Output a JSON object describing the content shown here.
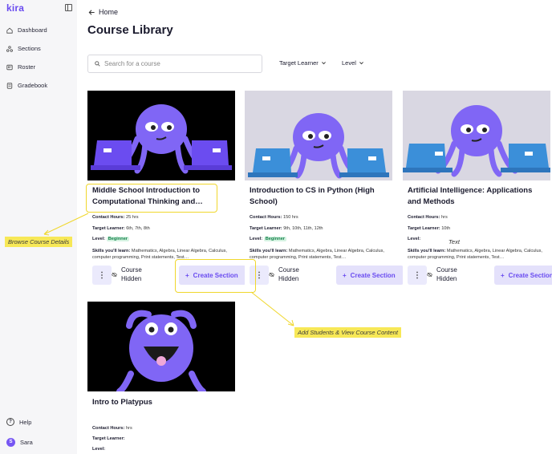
{
  "app": {
    "logo": "kira"
  },
  "sidebar": {
    "items": [
      {
        "label": "Dashboard",
        "icon": "home-icon"
      },
      {
        "label": "Sections",
        "icon": "sections-icon"
      },
      {
        "label": "Roster",
        "icon": "roster-icon"
      },
      {
        "label": "Gradebook",
        "icon": "gradebook-icon"
      }
    ],
    "help_label": "Help",
    "user": {
      "initial": "S",
      "name": "Sara"
    }
  },
  "header": {
    "back_label": "Home",
    "title": "Course Library"
  },
  "search": {
    "placeholder": "Search for a course",
    "value": ""
  },
  "filters": [
    {
      "label": "Target Learner"
    },
    {
      "label": "Level"
    }
  ],
  "courses": [
    {
      "title": "Middle School Introduction to Computational Thinking and…",
      "contact_hours_label": "Contact Hours:",
      "contact_hours": "25 hrs",
      "target_learner_label": "Target Learner:",
      "target_learner": "6th, 7th, 8th",
      "level_label": "Level:",
      "level": "Beginner",
      "skills_label": "Skills you'll learn:",
      "skills": "Mathematics, Algebra, Linear Algebra, Calculus, computer programming, Print statements, Test…",
      "status": "Course Hidden",
      "action": "Create Section",
      "image_bg": "#000000"
    },
    {
      "title": "Introduction to CS in Python (High School)",
      "contact_hours_label": "Contact Hours:",
      "contact_hours": "150 hrs",
      "target_learner_label": "Target Learner:",
      "target_learner": "9th, 10th, 11th, 12th",
      "level_label": "Level:",
      "level": "Beginner",
      "skills_label": "Skills you'll learn:",
      "skills": "Mathematics, Algebra, Linear Algebra, Calculus, computer programming, Print statements, Test…",
      "status": "Course Hidden",
      "action": "Create Section",
      "image_bg": "#d9d7e2"
    },
    {
      "title": "Artificial Intelligence: Applications and Methods",
      "contact_hours_label": "Contact Hours:",
      "contact_hours": "hrs",
      "target_learner_label": "Target Learner:",
      "target_learner": "10th",
      "level_label": "Level:",
      "level": "",
      "skills_label": "Skills you'll learn:",
      "skills": "Mathematics, Algebra, Linear Algebra, Calculus, computer programming, Print statements, Test…",
      "status": "Course Hidden",
      "action": "Create Section",
      "image_bg": "#d9d7e2"
    },
    {
      "title": "Intro to Platypus",
      "contact_hours_label": "Contact Hours:",
      "contact_hours": "hrs",
      "target_learner_label": "Target Learner:",
      "target_learner": "",
      "level_label": "Level:",
      "image_bg": "#000000"
    }
  ],
  "annotations": {
    "browse": "Browse Course Details",
    "add_students": "Add Students & View Course Content",
    "floating_text": "Text"
  },
  "colors": {
    "brand": "#6a4cf0",
    "octopus": "#8066f5",
    "laptop_dark": "#6b4cf0",
    "laptop_blue": "#3b8fd9",
    "annotation": "#f7e857",
    "badge_bg": "#d5f3e2",
    "badge_text": "#14804a"
  }
}
